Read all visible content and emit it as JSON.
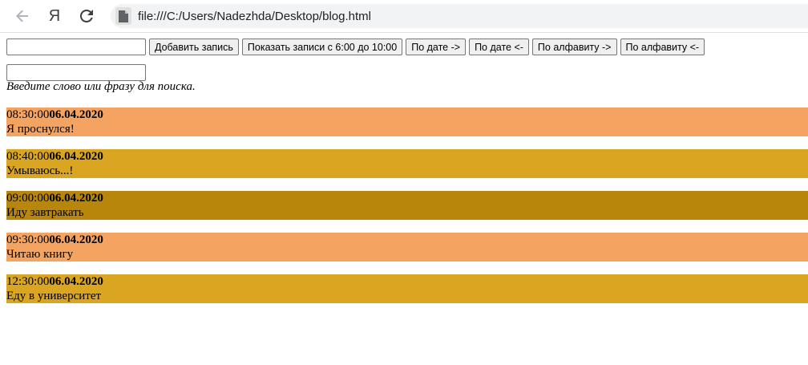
{
  "browser": {
    "back_icon": "arrow-left-icon",
    "yandex_logo": "Я",
    "reload_icon": "reload-icon",
    "url": "file:///C:/Users/Nadezhda/Desktop/blog.html"
  },
  "toolbar": {
    "entry_input_value": "",
    "buttons": [
      "Добавить запись",
      "Показать записи с 6:00 до 10:00",
      "По дате ->",
      "По дате <-",
      "По алфавиту ->",
      "По алфавиту <-"
    ]
  },
  "search": {
    "value": "",
    "hint": "Введите слово или фразу для поиска."
  },
  "entries": [
    {
      "time": "08:30:00",
      "date": "06.04.2020",
      "text": "Я проснулся!",
      "color": "#f4a460"
    },
    {
      "time": "08:40:00",
      "date": "06.04.2020",
      "text": "Умываюсь...!",
      "color": "#daa520"
    },
    {
      "time": "09:00:00",
      "date": "06.04.2020",
      "text": "Иду завтракать",
      "color": "#b8860b"
    },
    {
      "time": "09:30:00",
      "date": "06.04.2020",
      "text": "Читаю книгу",
      "color": "#f4a460"
    },
    {
      "time": "12:30:00",
      "date": "06.04.2020",
      "text": "Еду в университет",
      "color": "#daa520"
    }
  ]
}
